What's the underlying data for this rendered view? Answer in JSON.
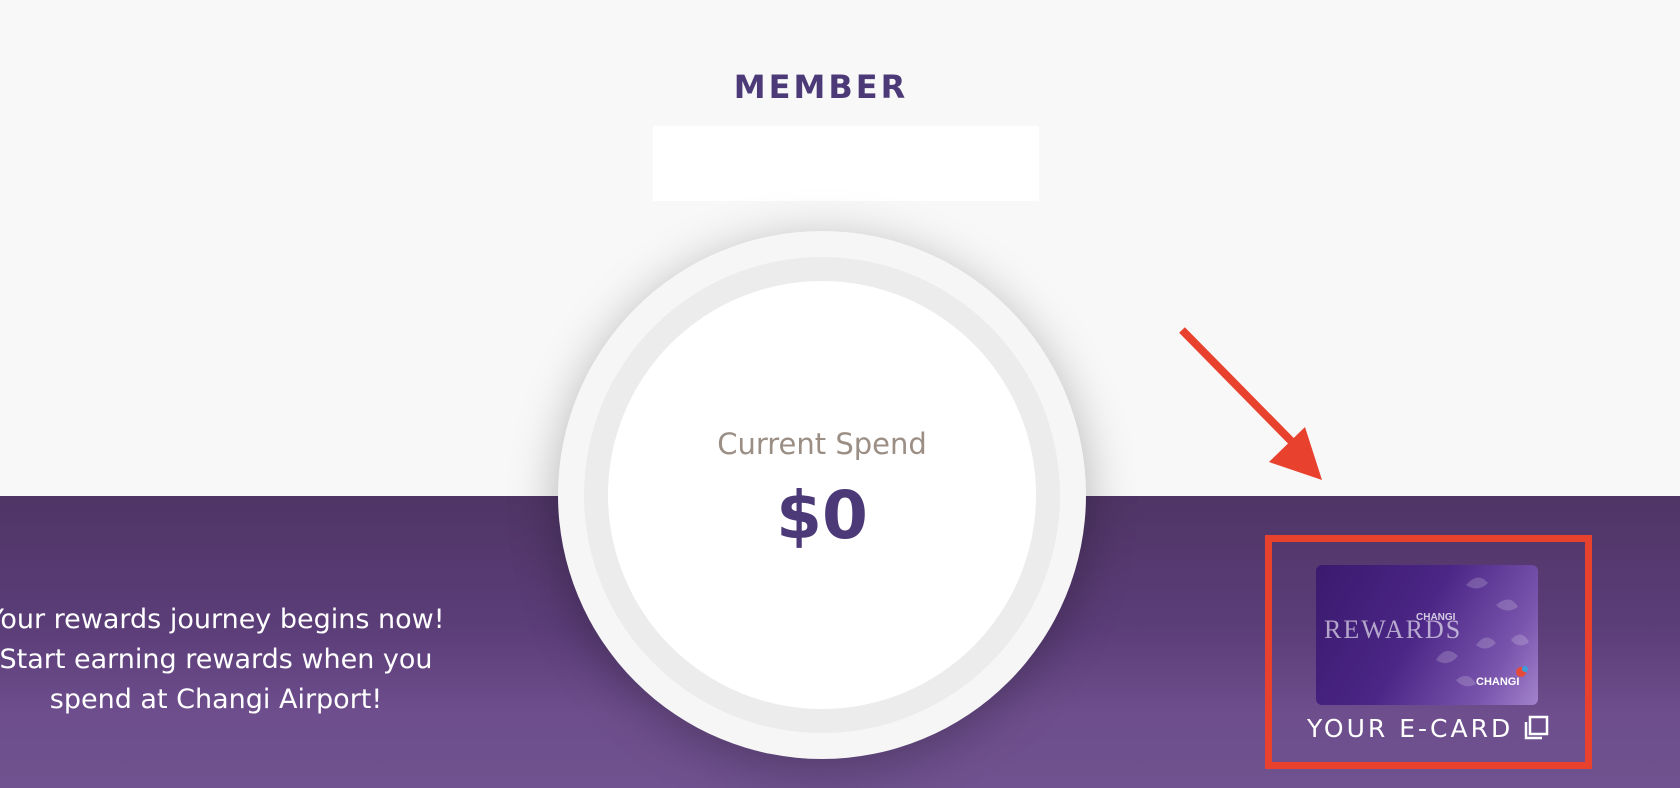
{
  "member": {
    "tier_title": "MEMBER",
    "name": ""
  },
  "spend": {
    "label": "Current Spend",
    "value": "$0"
  },
  "journey_message": {
    "text": "Your rewards journey begins now! Start earning rewards when you spend at Changi Airport!"
  },
  "ecard": {
    "label": "YOUR E-CARD",
    "icon": "copy-icon",
    "card_brand_small": "CHANGI",
    "card_brand_large": "REWARDS",
    "card_logo": "CHANGI"
  },
  "colors": {
    "brand_purple": "#4c3a78",
    "band_dark": "#4f3566",
    "band_light": "#6f528f",
    "highlight_red": "#e8412e",
    "spend_label_grey": "#9b8e84"
  }
}
